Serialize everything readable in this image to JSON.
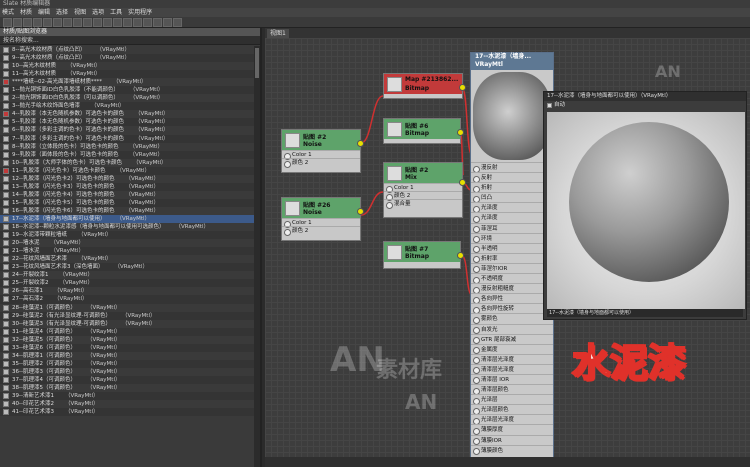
{
  "window": {
    "title": "Slate 材质编辑器"
  },
  "menu": [
    "模式",
    "材质",
    "编辑",
    "选择",
    "视图",
    "选项",
    "工具",
    "实用程序"
  ],
  "left_panel": {
    "header": "材质/贴图浏览器",
    "search": "按名称搜索...",
    "items": [
      {
        "label": "8--高光木纹材质（点纹凸凹）",
        "tag": "（VRayMtl）"
      },
      {
        "label": "9--高光木纹材质（点纹凸凹）",
        "tag": "（VRayMtl）"
      },
      {
        "label": "10--高光木纹材质",
        "tag": "（VRayMtl）"
      },
      {
        "label": "11--高光木纹材质",
        "tag": "（VRayMtl）"
      },
      {
        "label": "****墙纸--02-高光面漆墙纸材质****",
        "tag": "（VRayMtl）"
      },
      {
        "label": "1--抛光铜饰面ID白色乳胶漆（不能调颜色）",
        "tag": "（VRayMtl）"
      },
      {
        "label": "2--抛光铜饰面ID白色乳胶漆（可以调颜色）",
        "tag": "（VRayMtl）"
      },
      {
        "label": "3--抛光手绘木纹饰面色墙漆",
        "tag": "（VRayMtl）"
      },
      {
        "label": "4--乳胶漆（本无色随机参数）可选色卡的颜色",
        "tag": "（VRayMtl）"
      },
      {
        "label": "5--乳胶漆（本无色随机参数）可选色卡的颜色",
        "tag": "（VRayMtl）"
      },
      {
        "label": "6--乳胶漆（多彩主调的色卡）可选色卡的颜色",
        "tag": "（VRayMtl）"
      },
      {
        "label": "7--乳胶漆（多彩主调的色卡）可选色卡的颜色",
        "tag": "（VRayMtl）"
      },
      {
        "label": "8--乳胶漆（立体段的色卡）可选色卡的颜色",
        "tag": "（VRayMtl）"
      },
      {
        "label": "9--乳胶漆（面体段的色卡）可选色卡的颜色",
        "tag": "（VRayMtl）"
      },
      {
        "label": "10--乳胶漆（大师字体的色卡）可选色卡颜色",
        "tag": "（VRayMtl）"
      },
      {
        "label": "11--乳胶漆（闪光色卡）可选色卡颜色",
        "tag": "（VRayMtl）"
      },
      {
        "label": "12--乳胶漆（闪光色卡2）可选色卡的颜色",
        "tag": "（VRayMtl）"
      },
      {
        "label": "13--乳胶漆（闪光色卡3）可选色卡的颜色",
        "tag": "（VRayMtl）"
      },
      {
        "label": "14--乳胶漆（闪光色卡4）可选色卡的颜色",
        "tag": "（VRayMtl）"
      },
      {
        "label": "15--乳胶漆（闪光色卡5）可选色卡的颜色",
        "tag": "（VRayMtl）"
      },
      {
        "label": "16--乳胶漆（闪光色卡6）可选色卡的颜色",
        "tag": "（VRayMtl）"
      },
      {
        "label": "17--水泥漆（墙身与地面都可以使用）",
        "tag": "（VRayMtl）"
      },
      {
        "label": "18--水泥漆--颗粒水泥漆感（墙身与地面都可以使用可选颜色）",
        "tag": "（VRayMtl）"
      },
      {
        "label": "19--水泥漆带颗粒墙纸",
        "tag": "（VRayMtl）"
      },
      {
        "label": "20--墙水泥",
        "tag": "（VRayMtl）"
      },
      {
        "label": "21--墙水泥",
        "tag": "（VRayMtl）"
      },
      {
        "label": "22--花纹风墙面艺术漆",
        "tag": "（VRayMtl）"
      },
      {
        "label": "23--花纹风墙面艺术漆3（深色墙面）",
        "tag": "（VRayMtl）"
      },
      {
        "label": "24--开裂纹漆1",
        "tag": "（VRayMtl）"
      },
      {
        "label": "25--开裂纹漆2",
        "tag": "（VRayMtl）"
      },
      {
        "label": "26--高石漆1",
        "tag": "（VRayMtl）"
      },
      {
        "label": "27--高石漆2",
        "tag": "（VRayMtl）"
      },
      {
        "label": "28--硅藻泥1（可调颜色）",
        "tag": "（VRayMtl）"
      },
      {
        "label": "29--硅藻泥2（有光泽显纹理-可调颜色）",
        "tag": "（VRayMtl）"
      },
      {
        "label": "30--硅藻泥3（有光泽显纹理-可调颜色）",
        "tag": "（VRayMtl）"
      },
      {
        "label": "31--硅藻泥4（可调颜色）",
        "tag": "（VRayMtl）"
      },
      {
        "label": "32--硅藻泥5（可调颜色）",
        "tag": "（VRayMtl）"
      },
      {
        "label": "33--硅藻泥6（可调颜色）",
        "tag": "（VRayMtl）"
      },
      {
        "label": "34--肌理漆1（可调颜色）",
        "tag": "（VRayMtl）"
      },
      {
        "label": "35--肌理漆2（可调颜色）",
        "tag": "（VRayMtl）"
      },
      {
        "label": "36--肌理漆3（可调颜色）",
        "tag": "（VRayMtl）"
      },
      {
        "label": "37--肌理漆4（可调颜色）",
        "tag": "（VRayMtl）"
      },
      {
        "label": "38--肌理漆5（可调颜色）",
        "tag": "（VRayMtl）"
      },
      {
        "label": "39--清新艺术漆1",
        "tag": "（VRayMtl）"
      },
      {
        "label": "40--印花艺术漆2",
        "tag": "（VRayMtl）"
      },
      {
        "label": "41--印花艺术漆3",
        "tag": "（VRayMtl）"
      }
    ],
    "selected_index": 21
  },
  "view": {
    "tab": "视图1"
  },
  "nodes": {
    "map_top": {
      "t1": "Map #213862...",
      "t2": "Bitmap"
    },
    "noise1": {
      "t1": "贴图 #2",
      "t2": "Noise",
      "slots": [
        "Color 1",
        "颜色 2"
      ]
    },
    "bitmap6": {
      "t1": "贴图 #6",
      "t2": "Bitmap"
    },
    "mix": {
      "t1": "贴图 #2",
      "t2": "Mix",
      "slots": [
        "Color 1",
        "颜色 2",
        "混合量"
      ]
    },
    "noise26": {
      "t1": "贴图 #26",
      "t2": "Noise",
      "slots": [
        "Color 1",
        "颜色 2"
      ]
    },
    "bitmap7": {
      "t1": "贴图 #7",
      "t2": "Bitmap"
    }
  },
  "vray_node": {
    "title": "17--水泥漆（墙身...",
    "type": "VRayMtl",
    "slots": [
      "漫反射",
      "反射",
      "折射",
      "凹凸",
      "光泽度",
      "光泽度",
      "菲涅耳",
      "环境",
      "半透明",
      "折射率",
      "菲涅尔IOR",
      "不透明度",
      "漫反射粗糙度",
      "各向异性",
      "各向异性旋转",
      "雾颜色",
      "自发光",
      "GTR 尾部衰减",
      "金属度",
      "清漆层光泽度",
      "清漆层光泽度",
      "清漆层 IOR",
      "清漆层颜色",
      "光泽层",
      "光泽层颜色",
      "光泽层光泽度",
      "薄膜厚度",
      "薄膜IOR",
      "薄膜颜色"
    ]
  },
  "preview": {
    "title": "17--水泥漆（墙身与地面都可以使用）（VRayMtl）",
    "auto_label": "自动",
    "footer": "17--水泥漆（墙身与地面都可以使用）"
  },
  "overlay": {
    "big_text": "水泥漆",
    "watermark": "AN",
    "watermark_text": "素材库"
  }
}
